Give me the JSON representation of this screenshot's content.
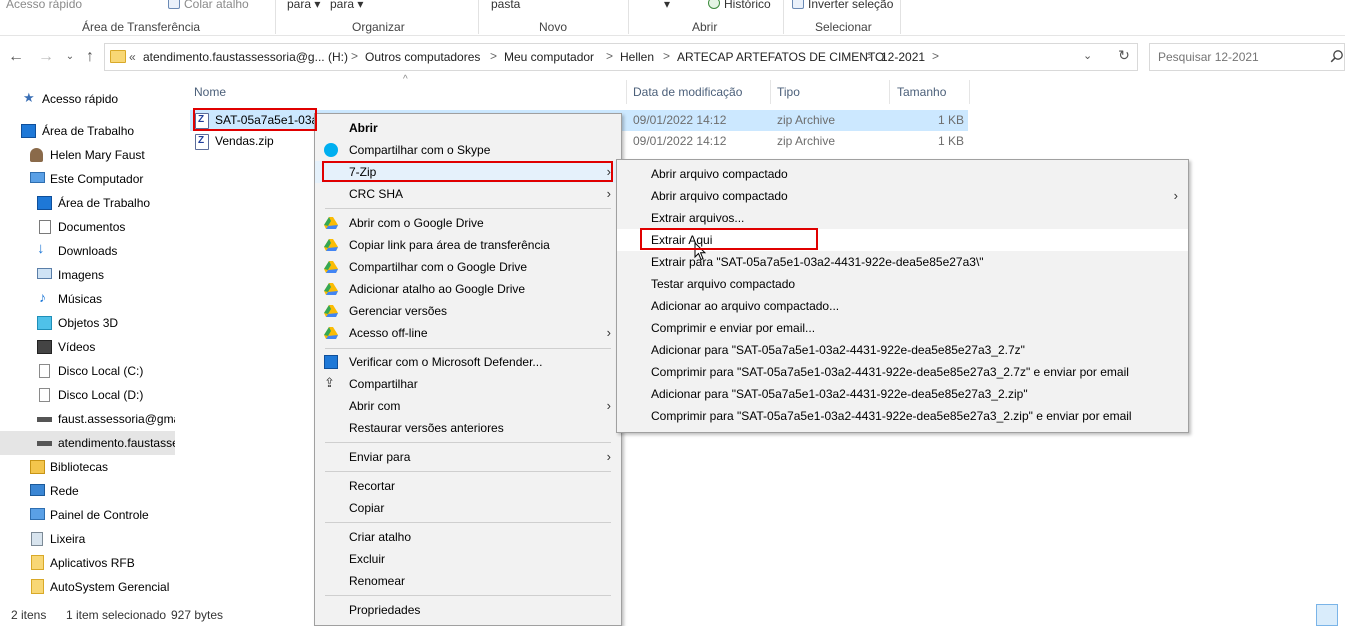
{
  "ribbon": {
    "items": [
      "Acesso rápido",
      "Colar atalho",
      "para ▾",
      "para ▾",
      "pasta",
      "▾",
      "Histórico",
      "Inverter seleção"
    ],
    "groups": [
      "Área de Transferência",
      "Organizar",
      "Novo",
      "Abrir",
      "Selecionar"
    ]
  },
  "address": {
    "collapsed": "«",
    "crumbs": [
      "atendimento.faustassessoria@g... (H:)",
      "Outros computadores",
      "Meu computador",
      "Hellen",
      "ARTECAP ARTEFATOS DE CIMENTO",
      "12-2021"
    ],
    "separator": ">"
  },
  "search": {
    "placeholder": "Pesquisar 12-2021"
  },
  "sidebar": {
    "items": [
      {
        "label": "Acesso rápido",
        "icon": "star-icon"
      },
      {
        "label": "Área de Trabalho",
        "icon": "desktop-icon"
      },
      {
        "label": "Helen Mary Faust",
        "icon": "user-icon"
      },
      {
        "label": "Este Computador",
        "icon": "computer-icon"
      },
      {
        "label": "Área de Trabalho",
        "icon": "desktop-icon"
      },
      {
        "label": "Documentos",
        "icon": "document-icon"
      },
      {
        "label": "Downloads",
        "icon": "download-icon"
      },
      {
        "label": "Imagens",
        "icon": "image-icon"
      },
      {
        "label": "Músicas",
        "icon": "music-icon"
      },
      {
        "label": "Objetos 3D",
        "icon": "cube-icon"
      },
      {
        "label": "Vídeos",
        "icon": "video-icon"
      },
      {
        "label": "Disco Local (C:)",
        "icon": "drive-icon"
      },
      {
        "label": "Disco Local (D:)",
        "icon": "drive-icon"
      },
      {
        "label": "faust.assessoria@gma",
        "icon": "network-drive-icon"
      },
      {
        "label": "atendimento.faustasse",
        "icon": "network-drive-icon"
      },
      {
        "label": "Bibliotecas",
        "icon": "library-icon"
      },
      {
        "label": "Rede",
        "icon": "network-icon"
      },
      {
        "label": "Painel de Controle",
        "icon": "control-panel-icon"
      },
      {
        "label": "Lixeira",
        "icon": "recycle-bin-icon"
      },
      {
        "label": "Aplicativos RFB",
        "icon": "folder-icon"
      },
      {
        "label": "AutoSystem Gerencial",
        "icon": "folder-icon"
      }
    ]
  },
  "columns": [
    "Nome",
    "Data de modificação",
    "Tipo",
    "Tamanho"
  ],
  "files": [
    {
      "name": "SAT-05a7a5e1-03a2",
      "date": "09/01/2022 14:12",
      "type": "zip Archive",
      "size": "1 KB"
    },
    {
      "name": "Vendas.zip",
      "date": "09/01/2022 14:12",
      "type": "zip Archive",
      "size": "1 KB"
    }
  ],
  "status": {
    "count": "2 itens",
    "selected": "1 item selecionado",
    "size": "927 bytes"
  },
  "context_menu": {
    "items": [
      "Abrir",
      "Compartilhar com o Skype",
      "7-Zip",
      "CRC SHA",
      "Abrir com o Google Drive",
      "Copiar link para área de transferência",
      "Compartilhar com o Google Drive",
      "Adicionar atalho ao Google Drive",
      "Gerenciar versões",
      "Acesso off-line",
      "Verificar com o Microsoft Defender...",
      "Compartilhar",
      "Abrir com",
      "Restaurar versões anteriores",
      "Enviar para",
      "Recortar",
      "Copiar",
      "Criar atalho",
      "Excluir",
      "Renomear",
      "Propriedades"
    ]
  },
  "submenu": {
    "items": [
      "Abrir arquivo compactado",
      "Abrir arquivo compactado",
      "Extrair arquivos...",
      "Extrair Aqui",
      "Extrair para \"SAT-05a7a5e1-03a2-4431-922e-dea5e85e27a3\\\"",
      "Testar arquivo compactado",
      "Adicionar ao arquivo compactado...",
      "Comprimir e enviar por email...",
      "Adicionar para \"SAT-05a7a5e1-03a2-4431-922e-dea5e85e27a3_2.7z\"",
      "Comprimir para \"SAT-05a7a5e1-03a2-4431-922e-dea5e85e27a3_2.7z\" e enviar por email",
      "Adicionar para \"SAT-05a7a5e1-03a2-4431-922e-dea5e85e27a3_2.zip\"",
      "Comprimir para \"SAT-05a7a5e1-03a2-4431-922e-dea5e85e27a3_2.zip\" e enviar por email"
    ]
  },
  "colors": {
    "highlight": "#e00000",
    "selection": "#cce8ff",
    "menu_bg": "#f2f2f2"
  }
}
